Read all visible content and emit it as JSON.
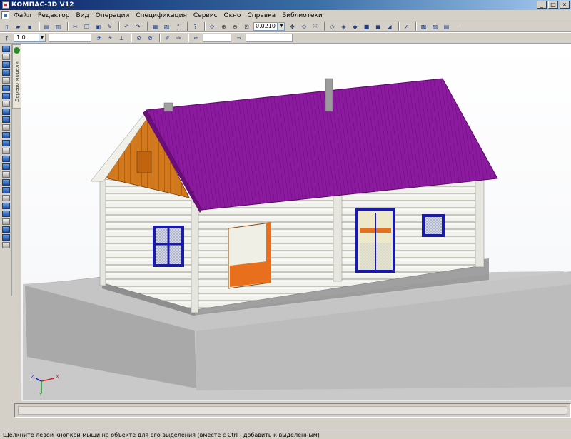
{
  "window": {
    "title": "КОМПАС-3D V12"
  },
  "menu": {
    "items": [
      {
        "label": "Файл"
      },
      {
        "label": "Редактор"
      },
      {
        "label": "Вид"
      },
      {
        "label": "Операции"
      },
      {
        "label": "Спецификация"
      },
      {
        "label": "Сервис"
      },
      {
        "label": "Окно"
      },
      {
        "label": "Справка"
      },
      {
        "label": "Библиотеки"
      }
    ]
  },
  "toolbar": {
    "zoom_value": "0.0210",
    "step_value": "1.0"
  },
  "tree_tab": {
    "label": "Дерево модели"
  },
  "axis": {
    "x": "X",
    "y": "Y",
    "z": "Z"
  },
  "status": {
    "hint": "Щелкните левой кнопкой мыши на объекте для его выделения (вместе с Ctrl - добавить к выделенным)"
  },
  "colors": {
    "roof": "#8b1a9e",
    "gable": "#d4781a",
    "window_frame": "#1a1aa8",
    "door": "#e8701c",
    "foundation": "#a6a6a6",
    "ground": "#c8c8c8"
  }
}
